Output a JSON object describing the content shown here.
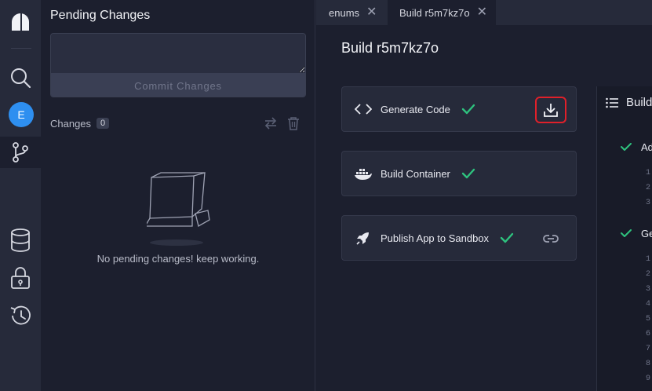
{
  "rail": {
    "avatar_letter": "E",
    "icons": [
      "app-logo-icon",
      "search-icon",
      "git-branch-icon",
      "database-icon",
      "lock-icon",
      "history-icon"
    ]
  },
  "pending": {
    "title": "Pending Changes",
    "commit_placeholder": "",
    "commit_button": "Commit Changes",
    "changes_label": "Changes",
    "changes_count": "0",
    "empty_text": "No pending changes! keep working."
  },
  "tabs": [
    {
      "label": "enums",
      "active": false
    },
    {
      "label": "Build r5m7kz7o",
      "active": true
    }
  ],
  "main": {
    "title": "Build r5m7kz7o",
    "steps": [
      {
        "label": "Generate Code",
        "icon": "code-icon",
        "status": "success",
        "action": "download-icon"
      },
      {
        "label": "Build Container",
        "icon": "docker-icon",
        "status": "success",
        "action": ""
      },
      {
        "label": "Publish App to Sandbox",
        "icon": "rocket-icon",
        "status": "success",
        "action": "link-icon"
      }
    ]
  },
  "log": {
    "title": "Build",
    "steps": [
      {
        "label": "Ad",
        "lines": [
          "1",
          "2",
          "3"
        ]
      },
      {
        "label": "Ge",
        "lines": [
          "1",
          "2",
          "3",
          "4",
          "5",
          "6",
          "7",
          "8",
          "9"
        ]
      }
    ]
  },
  "colors": {
    "accent_green": "#2ec27e",
    "avatar_blue": "#2e8ff0",
    "highlight_red": "#e0202a"
  }
}
